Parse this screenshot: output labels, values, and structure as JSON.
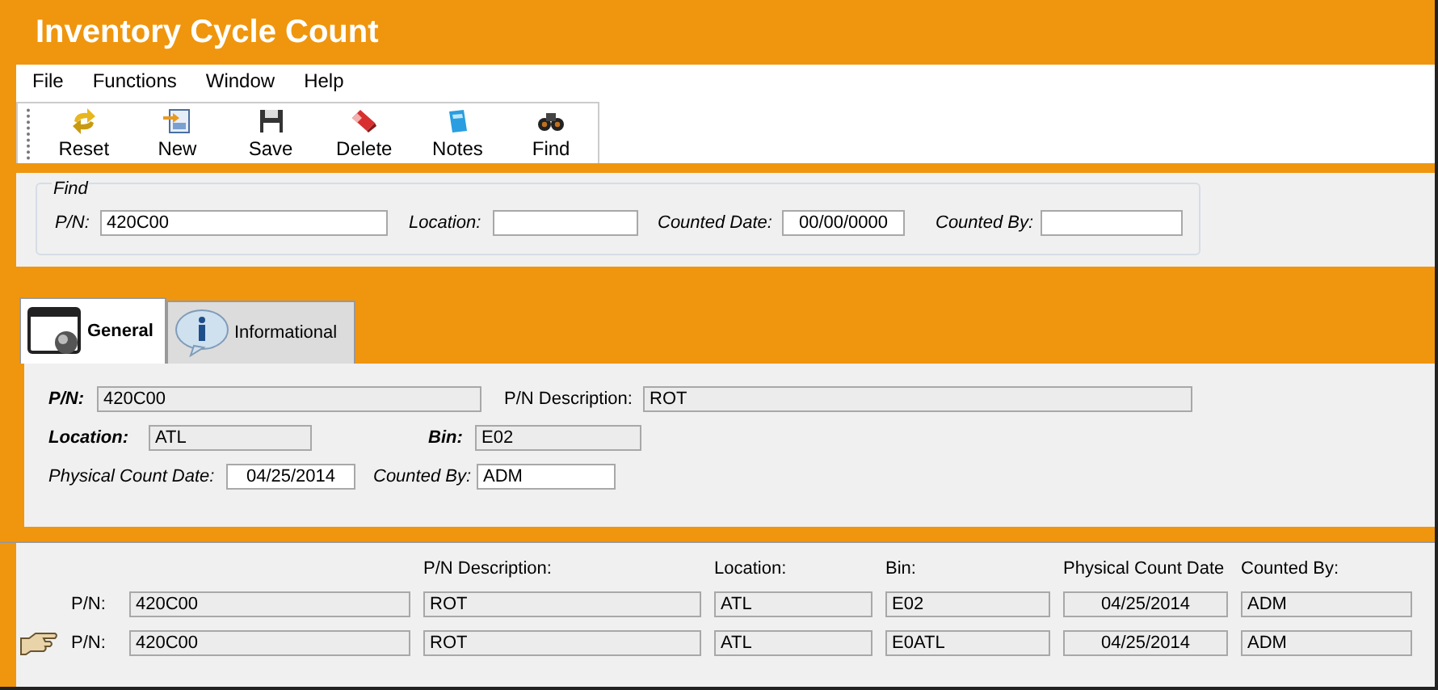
{
  "window": {
    "title": "Inventory Cycle Count"
  },
  "menu": [
    "File",
    "Functions",
    "Window",
    "Help"
  ],
  "toolbar": [
    {
      "label": "Reset",
      "kind": "reset"
    },
    {
      "label": "New",
      "kind": "new"
    },
    {
      "label": "Save",
      "kind": "save"
    },
    {
      "label": "Delete",
      "kind": "delete"
    },
    {
      "label": "Notes",
      "kind": "notes"
    },
    {
      "label": "Find",
      "kind": "find"
    }
  ],
  "find": {
    "title": "Find",
    "fields": [
      {
        "label": "P/N:",
        "value": "420C00"
      },
      {
        "label": "Location:"
      },
      {
        "label": "Counted Date:",
        "value": "00/00/0000"
      },
      {
        "label": "Counted By:"
      }
    ]
  },
  "tabs": [
    {
      "label": "General",
      "selected": true,
      "kind": "window"
    },
    {
      "label": "Informational",
      "selected": false,
      "kind": "info"
    }
  ],
  "general": {
    "rows": [
      [
        {
          "label": "P/N:",
          "value": "420C00",
          "kind": "key"
        },
        {
          "label": "P/N Description:",
          "value": "ROT",
          "kind": "plain"
        }
      ],
      [
        {
          "label": "Location:",
          "value": "ATL",
          "kind": "key"
        },
        {
          "label": "Bin:",
          "value": "E02",
          "kind": "key"
        }
      ],
      [
        {
          "label": "Physical Count Date:",
          "value": "04/25/2014",
          "kind": "entry"
        },
        {
          "label": "Counted By:",
          "value": "ADM",
          "kind": "entry"
        }
      ]
    ]
  },
  "list": {
    "columns": [
      "",
      "P/N Description:",
      "Location:",
      "Bin:",
      "Physical Count Date",
      "Counted By:"
    ],
    "rows": [
      {
        "selected": false,
        "label": "P/N:",
        "cells": [
          "420C00",
          "ROT",
          "ATL",
          "E02",
          "04/25/2014",
          "ADM"
        ]
      },
      {
        "selected": true,
        "label": "P/N:",
        "cells": [
          "420C00",
          "ROT",
          "ATL",
          "E0ATL",
          "04/25/2014",
          "ADM"
        ]
      }
    ]
  }
}
